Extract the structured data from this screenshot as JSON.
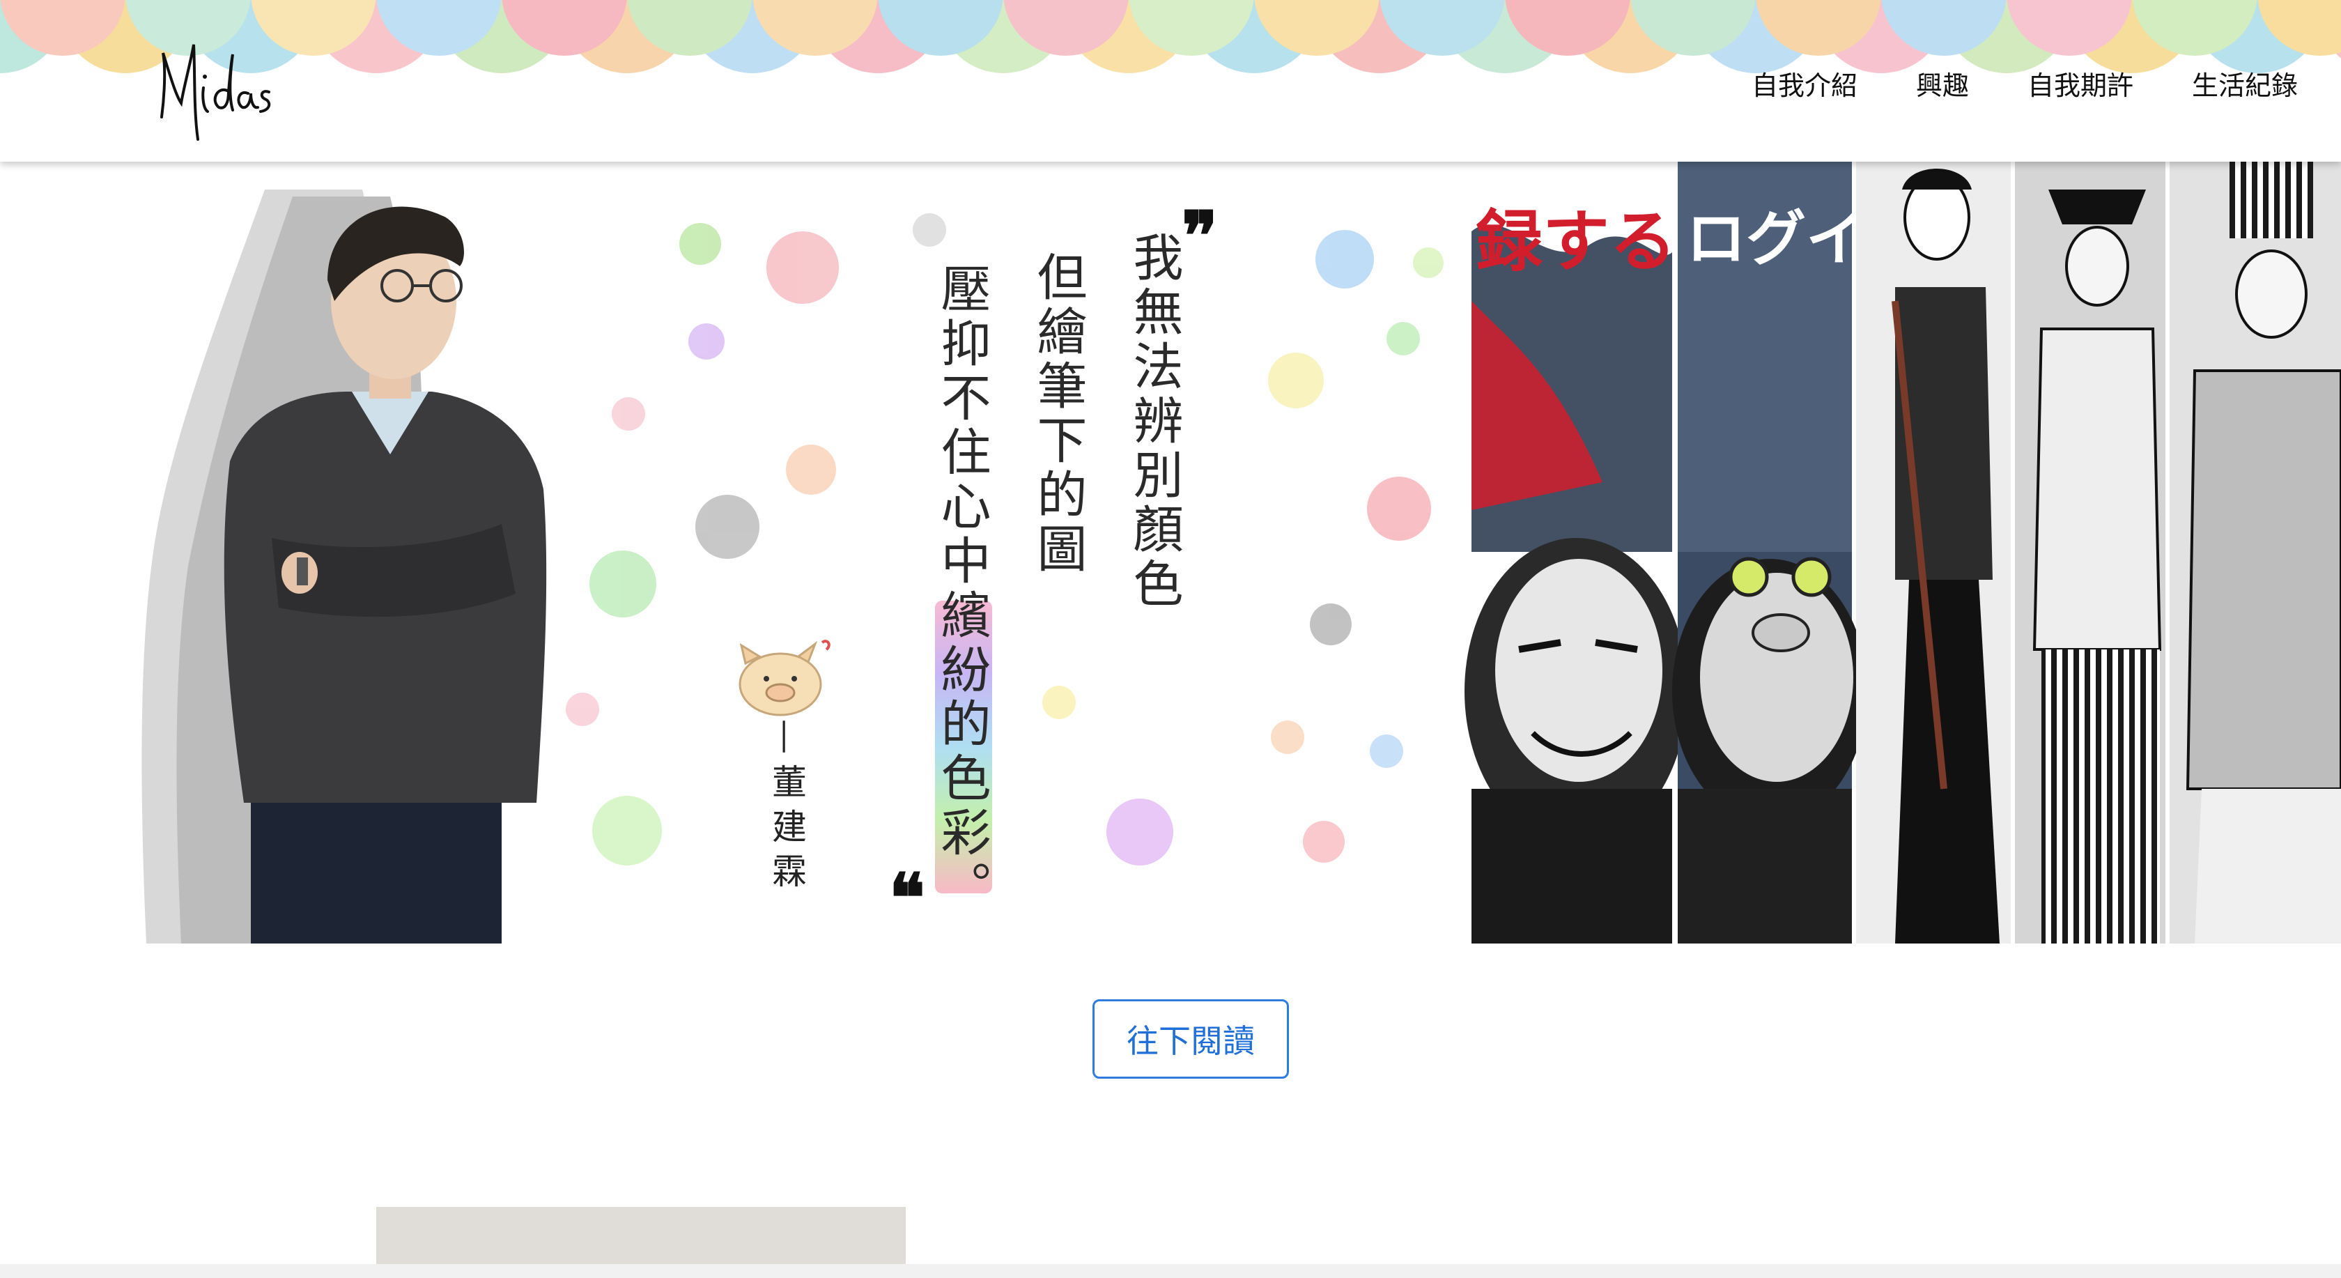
{
  "header": {
    "logo_text": "Midas",
    "nav": [
      {
        "label": "自我介紹"
      },
      {
        "label": "興趣"
      },
      {
        "label": "自我期許"
      },
      {
        "label": "生活紀錄"
      }
    ]
  },
  "hero": {
    "quote_lines": [
      "我無法辨別顏色",
      "但繪筆下的圖",
      "壓抑不住心中繽紛的色彩。"
    ],
    "quote_open_mark": "❞",
    "quote_close_mark": "❝",
    "attribution": "—董建霖",
    "manga_text": [
      "録する",
      "ログイン"
    ]
  },
  "actions": {
    "read_more_label": "往下閱讀"
  },
  "colors": {
    "button_accent": "#2f7ce0",
    "header_bg": "#ffffff",
    "bottom_block": "#e0ddd8"
  }
}
